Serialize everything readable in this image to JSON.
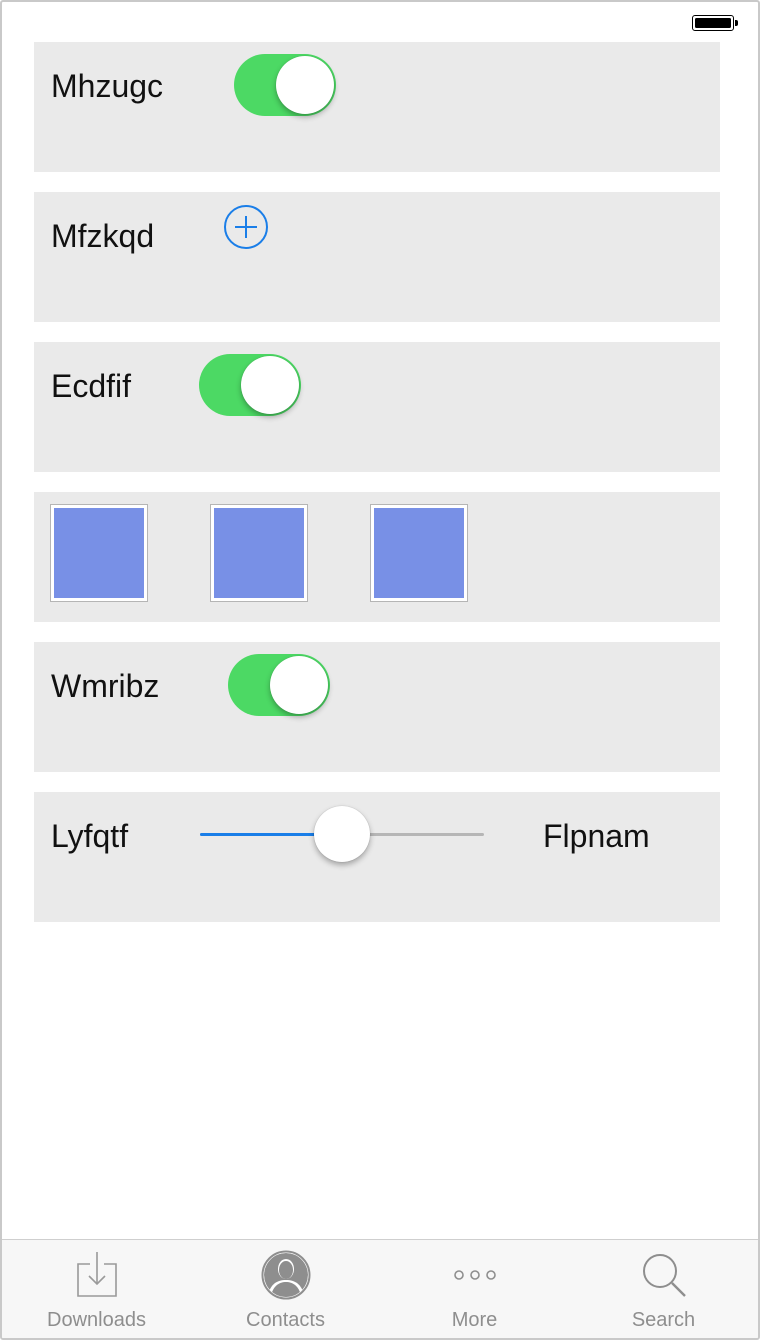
{
  "status_bar": {
    "battery_icon": "battery-full-icon"
  },
  "rows": [
    {
      "label": "Mhzugc",
      "control": "toggle",
      "on": true
    },
    {
      "label": "Mfzkqd",
      "control": "add-button",
      "icon": "plus-circle-icon"
    },
    {
      "label": "Ecdfif",
      "control": "toggle",
      "on": true
    },
    {
      "control": "image-tiles",
      "tile_count": 3,
      "tile_color": "#7890e6"
    },
    {
      "label": "Wmribz",
      "control": "toggle",
      "on": true
    },
    {
      "label": "Lyfqtf",
      "control": "slider",
      "value_fraction": 0.5,
      "right_label": "Flpnam"
    }
  ],
  "colors": {
    "toggle_on": "#4cd964",
    "accent_blue": "#1a7ee8",
    "card_bg": "#eaeaea"
  },
  "tabbar": {
    "tabs": [
      {
        "label": "Downloads",
        "icon": "download-tray-icon"
      },
      {
        "label": "Contacts",
        "icon": "person-circle-icon"
      },
      {
        "label": "More",
        "icon": "ellipsis-icon"
      },
      {
        "label": "Search",
        "icon": "magnifier-icon"
      }
    ]
  }
}
